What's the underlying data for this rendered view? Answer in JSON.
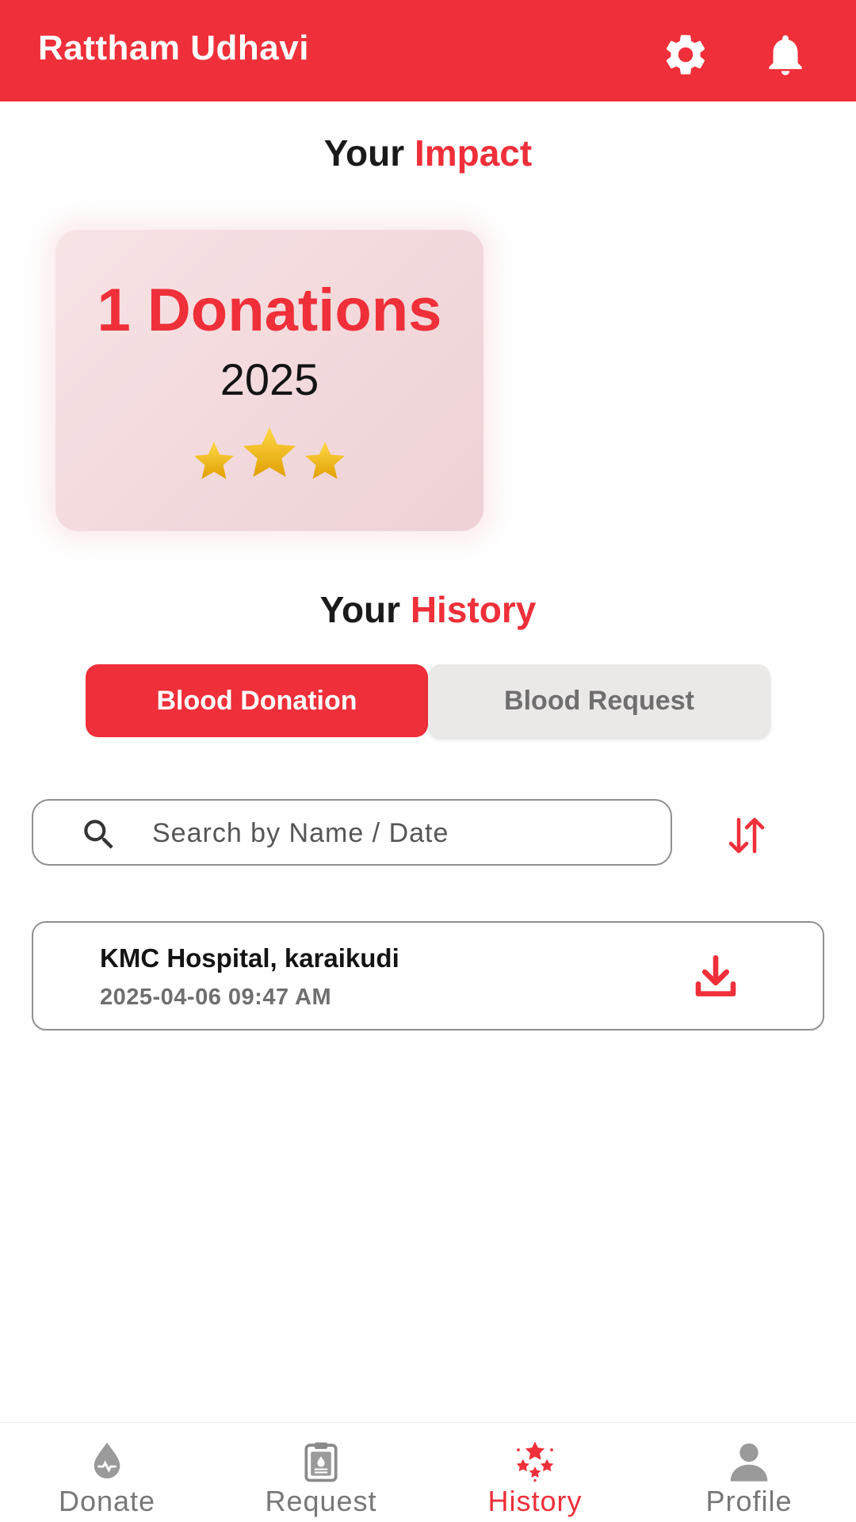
{
  "header": {
    "title": "Rattham Udhavi",
    "icons": [
      "gear-icon",
      "bell-icon"
    ]
  },
  "impact": {
    "title_prefix": "Your",
    "title_accent": "Impact",
    "count_label": "1 Donations",
    "year": "2025",
    "stars": 3
  },
  "history": {
    "title_prefix": "Your",
    "title_accent": "History",
    "tabs": [
      {
        "label": "Blood Donation",
        "active": true
      },
      {
        "label": "Blood Request",
        "active": false
      }
    ],
    "search": {
      "placeholder": "Search by Name / Date",
      "value": ""
    },
    "items": [
      {
        "name": "KMC Hospital, karaikudi",
        "datetime": "2025-04-06 09:47 AM"
      }
    ]
  },
  "bottom_nav": {
    "items": [
      {
        "label": "Donate",
        "icon": "blood-drop-icon"
      },
      {
        "label": "Request",
        "icon": "clipboard-icon"
      },
      {
        "label": "History",
        "icon": "stars-icon"
      },
      {
        "label": "Profile",
        "icon": "person-icon"
      }
    ],
    "active": "History"
  },
  "colors": {
    "accent": "#ef2f39",
    "inactive_tab": "#ebe8e8",
    "muted_text": "#777777",
    "star": "#f2b90f"
  }
}
